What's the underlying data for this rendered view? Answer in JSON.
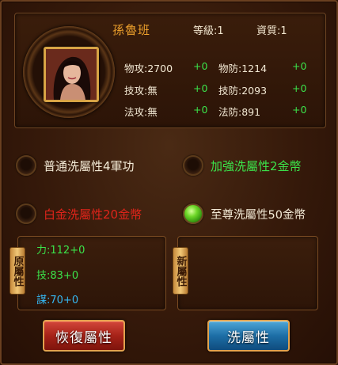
{
  "hero": {
    "name": "孫魯班",
    "level_label": "等級:1",
    "quality_label": "資質:1",
    "stats": [
      {
        "label": "物攻:2700",
        "bonus": "+0"
      },
      {
        "label": "物防:1214",
        "bonus": "+0"
      },
      {
        "label": "技攻:無",
        "bonus": "+0"
      },
      {
        "label": "技防:2093",
        "bonus": "+0"
      },
      {
        "label": "法攻:無",
        "bonus": "+0"
      },
      {
        "label": "法防:891",
        "bonus": "+0"
      }
    ]
  },
  "options": [
    {
      "label": "普通洗屬性4軍功",
      "selected": false,
      "color": "#f3ead6"
    },
    {
      "label": "加強洗屬性2金幣",
      "selected": false,
      "color": "#3be24a"
    },
    {
      "label": "白金洗屬性20金幣",
      "selected": false,
      "color": "#e0241a"
    },
    {
      "label": "至尊洗屬性50金幣",
      "selected": true,
      "color": "#f3ead6"
    }
  ],
  "original_attrs": {
    "tag": "原屬性",
    "lines": [
      {
        "key": "力:",
        "value": "112+0"
      },
      {
        "key": "技:",
        "value": "83+0"
      },
      {
        "key": "謀:",
        "value": "70+0"
      }
    ]
  },
  "new_attrs": {
    "tag": "新屬性"
  },
  "buttons": {
    "restore": "恢復屬性",
    "wash": "洗屬性"
  }
}
